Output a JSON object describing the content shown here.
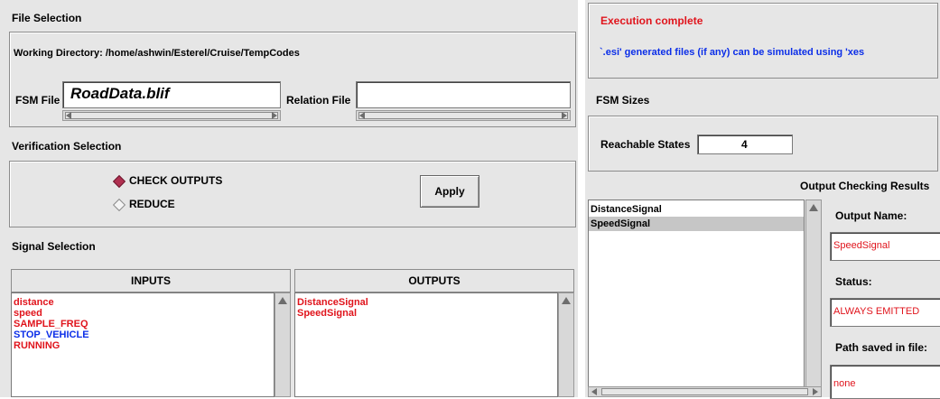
{
  "file_selection": {
    "title": "File Selection",
    "working_directory_label": "Working Directory:",
    "working_directory_value": "/home/ashwin/Esterel/Cruise/TempCodes",
    "fsm_file_label": "FSM File",
    "fsm_file_value": "RoadData.blif",
    "relation_file_label": "Relation File",
    "relation_file_value": ""
  },
  "verification": {
    "title": "Verification Selection",
    "options": [
      {
        "label": "CHECK OUTPUTS",
        "selected": true
      },
      {
        "label": "REDUCE",
        "selected": false
      }
    ],
    "apply_label": "Apply"
  },
  "signals": {
    "title": "Signal Selection",
    "inputs_header": "INPUTS",
    "outputs_header": "OUTPUTS",
    "inputs": [
      {
        "name": "distance",
        "color": "red"
      },
      {
        "name": "speed",
        "color": "red"
      },
      {
        "name": "SAMPLE_FREQ",
        "color": "red"
      },
      {
        "name": "STOP_VEHICLE",
        "color": "blue"
      },
      {
        "name": "RUNNING",
        "color": "red"
      }
    ],
    "outputs": [
      {
        "name": "DistanceSignal",
        "color": "red"
      },
      {
        "name": "SpeedSignal",
        "color": "red"
      }
    ]
  },
  "execution": {
    "status": "Execution complete",
    "message": "`.esi' generated files (if any) can be simulated using 'xes"
  },
  "fsm_sizes": {
    "title": "FSM Sizes",
    "reachable_label": "Reachable States",
    "reachable_value": "4"
  },
  "output_checking": {
    "title": "Output Checking Results",
    "signals": [
      "DistanceSignal",
      "SpeedSignal"
    ],
    "selected_signal": "SpeedSignal",
    "output_name_label": "Output Name:",
    "output_name_value": "SpeedSignal",
    "status_label": "Status:",
    "status_value": "ALWAYS EMITTED",
    "path_label": "Path saved in file:",
    "path_value": "none"
  },
  "colors": {
    "panel_bg": "#e6e6e6",
    "red_text": "#e0141c",
    "blue_text": "#0b2ee8",
    "selection_bg": "#c6c6c6"
  }
}
